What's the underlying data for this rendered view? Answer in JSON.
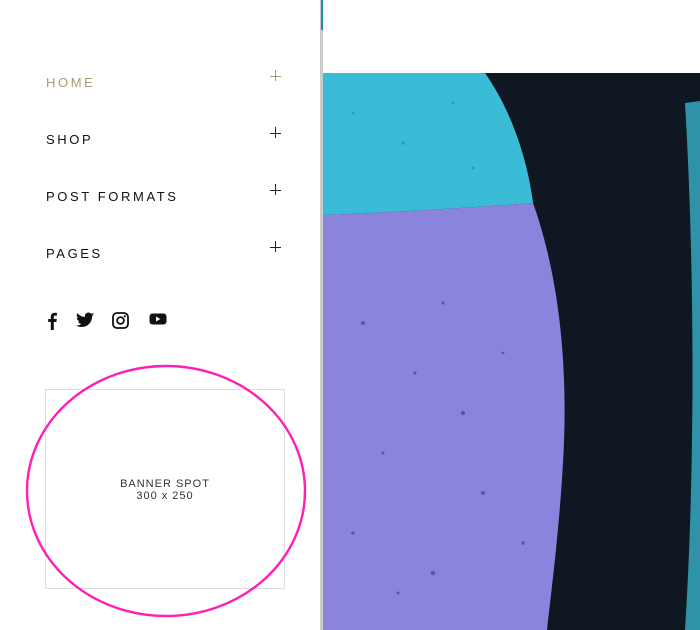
{
  "nav": {
    "items": [
      {
        "label": "HOME",
        "active": true
      },
      {
        "label": "SHOP",
        "active": false
      },
      {
        "label": "POST FORMATS",
        "active": false
      },
      {
        "label": "PAGES",
        "active": false
      }
    ]
  },
  "social": {
    "icons": [
      "facebook-icon",
      "twitter-icon",
      "instagram-icon",
      "youtube-icon"
    ]
  },
  "banner": {
    "line1": "BANNER SPOT",
    "line2": "300 x 250"
  },
  "colors": {
    "accent": "#a89b74",
    "highlight_ellipse": "#ff1fb4",
    "teal": "#3bbcd6",
    "lavender": "#8b84dc",
    "navy": "#0f1722"
  }
}
